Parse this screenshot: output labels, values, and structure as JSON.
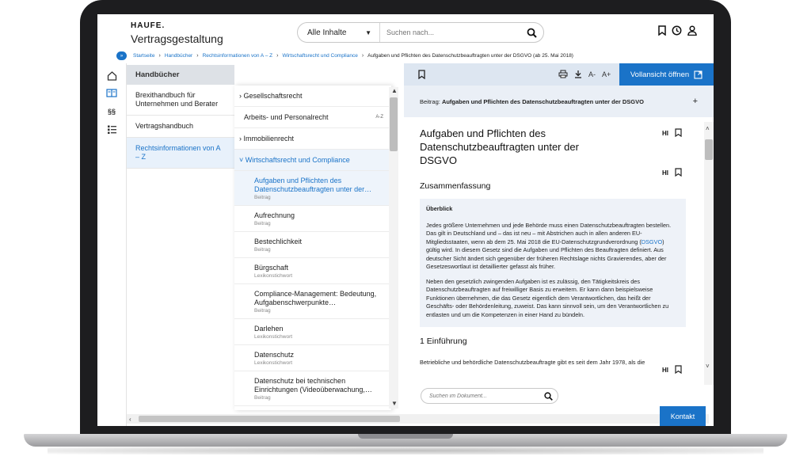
{
  "header": {
    "logo": "HAUFE.",
    "app_title": "Vertragsgestaltung",
    "search": {
      "scope": "Alle Inhalte",
      "placeholder": "Suchen nach..."
    }
  },
  "breadcrumb": {
    "toggle": "»",
    "items": [
      "Startseite",
      "Handbücher",
      "Rechtsinformationen von A – Z",
      "Wirtschaftsrecht und Compliance"
    ],
    "current": "Aufgaben und Pflichten des Datenschutzbeauftragten unter der DSGVO (ab 25. Mai 2018)"
  },
  "rail": {
    "paragraph_label": "§§"
  },
  "nav1": {
    "header": "Handbücher",
    "items": [
      "Brexithandbuch für Unternehmen und Berater",
      "Vertragshandbuch",
      "Rechtsinformationen von A – Z"
    ]
  },
  "nav2": {
    "items": [
      "Gesellschaftsrecht",
      "Arbeits- und Personalrecht",
      "Immobilienrecht",
      "Wirtschaftsrecht und Compliance"
    ],
    "az_label": "A-Z",
    "subitems": [
      {
        "title": "Aufgaben und Pflichten des Datenschutzbeauftragten unter der…",
        "kind": "Beitrag"
      },
      {
        "title": "Aufrechnung",
        "kind": "Beitrag"
      },
      {
        "title": "Bestechlichkeit",
        "kind": "Beitrag"
      },
      {
        "title": "Bürgschaft",
        "kind": "Lexikonstichwort"
      },
      {
        "title": "Compliance-Management: Bedeutung, Aufgabenschwerpunkte…",
        "kind": "Beitrag"
      },
      {
        "title": "Darlehen",
        "kind": "Lexikonstichwort"
      },
      {
        "title": "Datenschutz",
        "kind": "Lexikonstichwort"
      },
      {
        "title": "Datenschutz bei technischen Einrichtungen (Videoüberwachung,…",
        "kind": "Beitrag"
      }
    ]
  },
  "doc": {
    "font_smaller": "A-",
    "font_larger": "A+",
    "full_view_button": "Vollansicht öffnen",
    "beitrag_prefix": "Beitrag: ",
    "beitrag_title": "Aufgaben und Pflichten des Datenschutzbeauftragten unter der DSGVO",
    "plus": "+",
    "title": "Aufgaben und Pflichten des Datenschutzbeauftragten unter der DSGVO",
    "hl_label": "HI",
    "section_summary": "Zusammenfassung",
    "summary_heading": "Überblick",
    "summary_p1_a": "Jedes größere Unternehmen und jede Behörde muss einen Datenschutzbeauftragten bestellen. Das gilt in Deutschland und – das ist neu – mit Abstrichen auch in allen anderen EU-Mitgliedsstaaten, wenn ab dem 25. Mai 2018 die EU-Datenschutzgrundverordnung (",
    "summary_p1_link": "DSGVO",
    "summary_p1_b": ") gültig wird. In diesem Gesetz sind die Aufgaben und Pflichten des Beauftragten definiert. Aus deutscher Sicht ändert sich gegenüber der früheren Rechtslage nichts Gravierendes, aber der Gesetzeswortlaut ist detaillierter gefasst als früher.",
    "summary_p2": "Neben den gesetzlich zwingenden Aufgaben ist es zulässig, den Tätigkeitskreis des Datenschutzbeauftragten auf freiwilliger Basis zu erweitern. Er kann dann beispielsweise Funktionen übernehmen, die das Gesetz eigentlich dem Verantwortlichen, das heißt der Geschäfts- oder Behördenleitung, zuweist. Das kann sinnvoll sein, um den Verantwortlichen zu entlasten und um die Kompetenzen in einer Hand zu bündeln.",
    "section_intro": "1 Einführung",
    "intro_text": "Betriebliche und behördliche Datenschutzbeauftragte gibt es seit dem Jahr 1978, als die",
    "search_placeholder": "Suchen im Dokument...",
    "kontakt": "Kontakt"
  },
  "colors": {
    "accent": "#1a73c8",
    "panel": "#dde6f1",
    "bezel": "#1d1d1f"
  }
}
